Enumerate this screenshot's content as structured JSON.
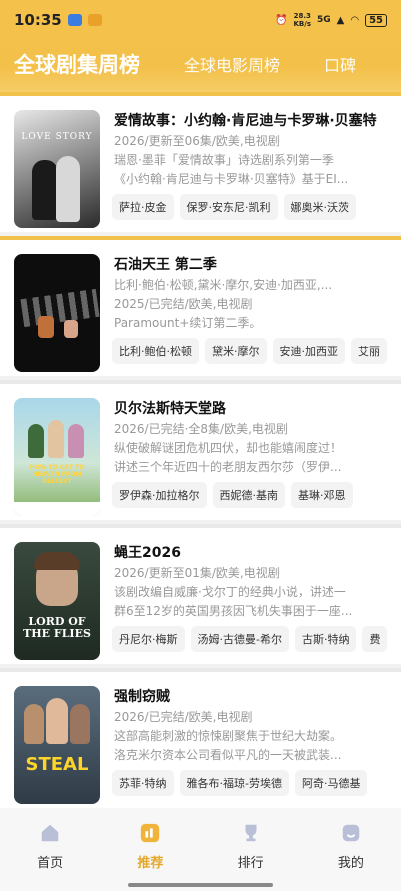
{
  "status_bar": {
    "time": "10:35",
    "network_speed": "28.3",
    "network_unit": "KB/s",
    "signal": "5G",
    "battery": "55"
  },
  "tabs": [
    "全球剧集周榜",
    "全球电影周榜",
    "口碑"
  ],
  "cards": [
    {
      "title": "爱情故事：小约翰·肯尼迪与卡罗琳·贝塞特",
      "meta1": "2026/更新至06集/欧美,电视剧",
      "meta2": "瑞恩·墨菲「爱情故事」诗选剧系列第一季",
      "meta3": "《小约翰·肯尼迪与卡罗琳·贝塞特》基于EI...",
      "chips": [
        "萨拉·皮金",
        "保罗·安东尼·凯利",
        "娜奥米·沃茨"
      ],
      "poster_text": "LOVE STORY"
    },
    {
      "title": "石油天王 第二季",
      "meta1": "比利·鲍伯·松顿,黛米·摩尔,安迪·加西亚,...",
      "meta2": "2025/已完结/欧美,电视剧",
      "meta3": "Paramount+续订第二季。",
      "chips": [
        "比利·鲍伯·松顿",
        "黛米·摩尔",
        "安迪·加西亚",
        "艾丽"
      ],
      "poster_text": ""
    },
    {
      "title": "贝尔法斯特天堂路",
      "meta1": "2026/已完结·全8集/欧美,电视剧",
      "meta2": "纵使破解谜团危机四伏，却也能嬉闹度过！",
      "meta3": "讲述三个年近四十的老朋友西尔莎（罗伊...",
      "chips": [
        "罗伊森·加拉格尔",
        "西妮德·基南",
        "基琳·邓恩"
      ],
      "poster_text": "HOW TO GET TO HEAVEN FROM BELFAST"
    },
    {
      "title": "蝇王2026",
      "meta1": "2026/更新至01集/欧美,电视剧",
      "meta2": "该剧改编自威廉·戈尔丁的经典小说，讲述一",
      "meta3": "群6至12岁的英国男孩因飞机失事困于一座...",
      "chips": [
        "丹尼尔·梅斯",
        "汤姆·古德曼-希尔",
        "古斯·特纳",
        "费"
      ],
      "poster_text": "LORD OF THE FLIES"
    },
    {
      "title": "强制窃贼",
      "meta1": "2026/已完结/欧美,电视剧",
      "meta2": "这部高能刺激的惊悚剧聚焦于世纪大劫案。",
      "meta3": "洛克米尔资本公司看似平凡的一天被武装...",
      "chips": [
        "苏菲·特纳",
        "雅各布·福琼-劳埃德",
        "阿奇·马德基"
      ],
      "poster_text": "STEAL"
    }
  ],
  "bottom_nav": [
    "首页",
    "推荐",
    "排行",
    "我的"
  ],
  "colors": {
    "accent": "#f3c04a",
    "active_nav": "#e3a82d"
  }
}
